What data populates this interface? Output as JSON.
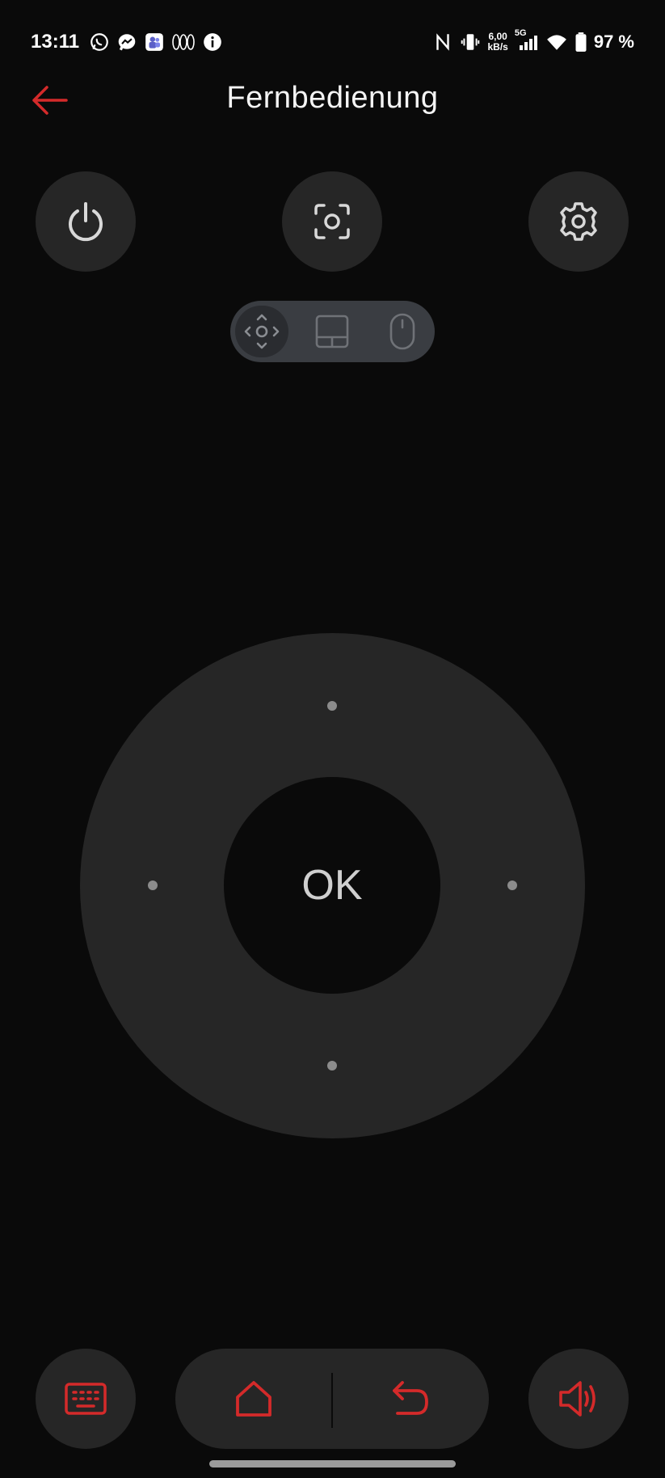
{
  "status_bar": {
    "time": "13:11",
    "net_speed_value": "6,00",
    "net_speed_unit": "kB/s",
    "network_type": "5G",
    "battery_percent": "97 %",
    "notification_icons": [
      "whatsapp-icon",
      "messenger-icon",
      "teams-icon",
      "app-icon",
      "info-icon"
    ]
  },
  "header": {
    "title": "Fernbedienung",
    "back_icon": "arrow-left-icon"
  },
  "top_controls": {
    "power_icon": "power-icon",
    "screenshot_icon": "screenshot-icon",
    "settings_icon": "gear-icon"
  },
  "mode_switch": {
    "options": [
      "dpad-mode-icon",
      "touchpad-mode-icon",
      "mouse-mode-icon"
    ],
    "selected_index": 0
  },
  "dpad": {
    "ok_label": "OK"
  },
  "bottom_controls": {
    "keyboard_icon": "keyboard-icon",
    "home_icon": "home-icon",
    "back_icon": "undo-arrow-icon",
    "volume_icon": "volume-icon"
  },
  "colors": {
    "accent": "#d42a2a",
    "background": "#0a0a0a",
    "surface": "#262626",
    "icon_light": "#d8d8d8",
    "mode_switch_bg": "#3a3d42"
  }
}
